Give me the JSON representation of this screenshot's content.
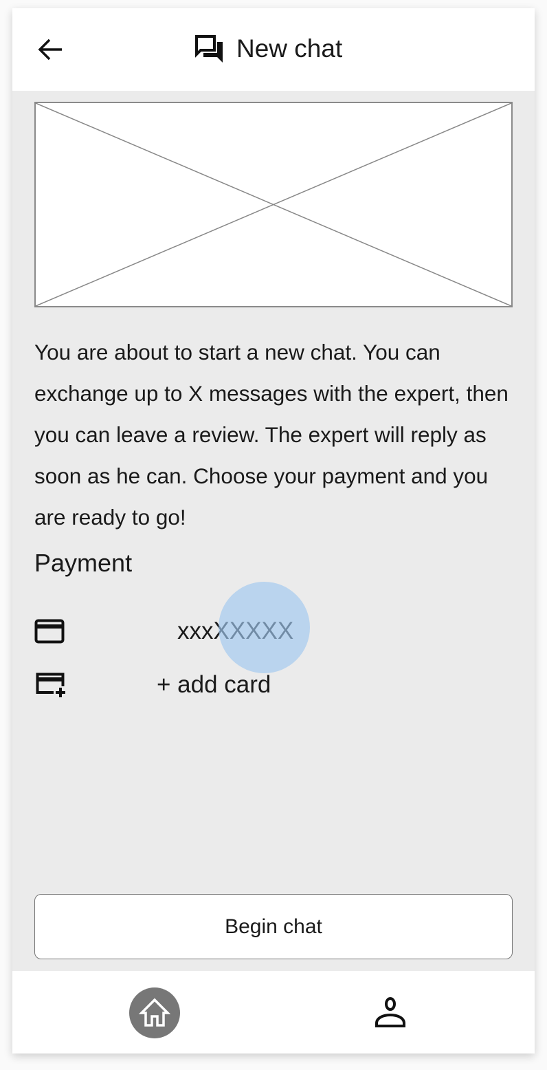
{
  "header": {
    "title": "New chat",
    "back_icon": "arrow-left-icon",
    "title_icon": "forum-icon"
  },
  "main": {
    "image_placeholder": "image-placeholder",
    "description": "You are about to start a new chat. You can exchange up to X messages with the expert, then you can leave a review. The expert will reply as soon as he can. Choose your payment and you are ready to go!",
    "payment_label": "Payment",
    "card": {
      "icon": "credit-card-icon",
      "number": "xxxXXXXX"
    },
    "add_card": {
      "icon": "add-card-icon",
      "label": "+ add card"
    },
    "begin_button": "Begin chat"
  },
  "nav": {
    "items": [
      {
        "icon": "home-icon",
        "active": true
      },
      {
        "icon": "person-icon",
        "active": false
      }
    ]
  },
  "colors": {
    "background": "#ebebeb",
    "surface": "#ffffff",
    "active_nav": "#777777",
    "click_indicator": "#a0c8f0"
  }
}
